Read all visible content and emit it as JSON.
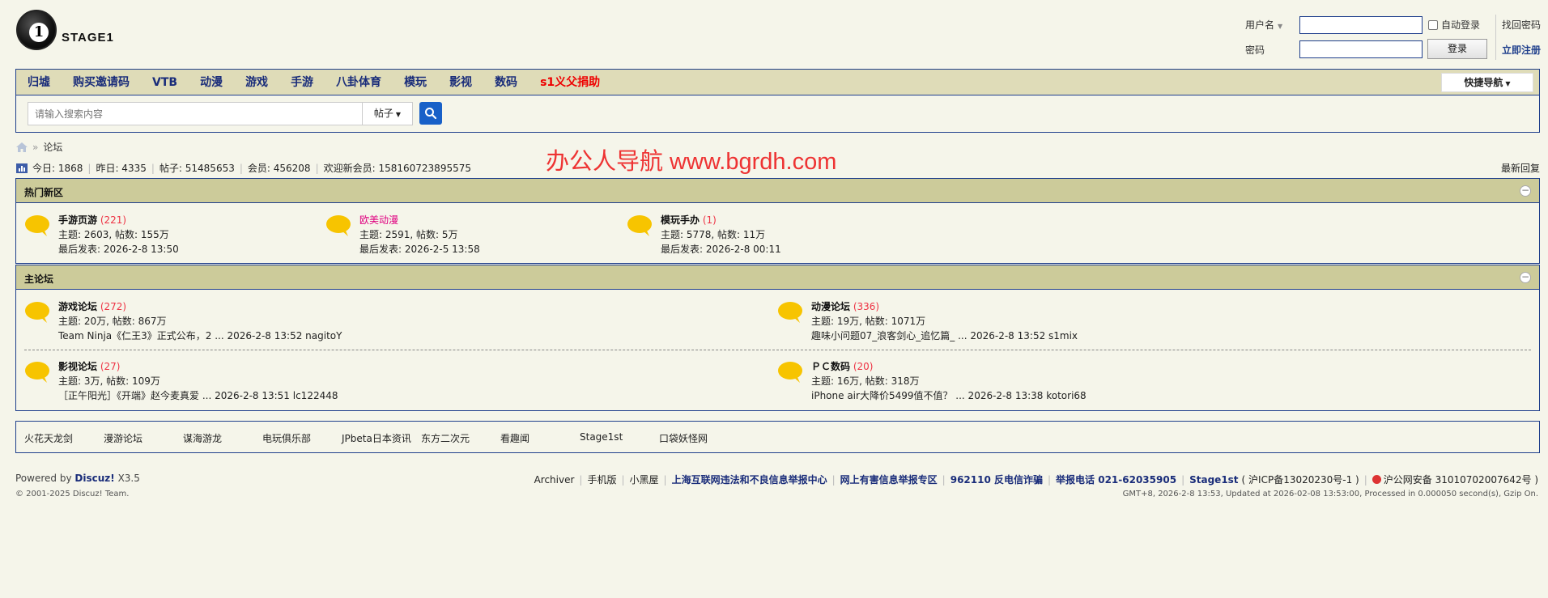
{
  "logo": {
    "text": "STAGE1",
    "digit": "1"
  },
  "login": {
    "username_label": "用户名",
    "password_label": "密码",
    "auto_login": "自动登录",
    "login_button": "登录",
    "find_password": "找回密码",
    "register": "立即注册"
  },
  "nav": {
    "items": [
      "归墟",
      "购买邀请码",
      "VTB",
      "动漫",
      "游戏",
      "手游",
      "八卦体育",
      "模玩",
      "影视",
      "数码",
      "s1义父捐助"
    ],
    "quick_nav": "快捷导航"
  },
  "search": {
    "placeholder": "请输入搜索内容",
    "type": "帖子"
  },
  "breadcrumb": {
    "current": "论坛",
    "separator": "»"
  },
  "stats": {
    "today": "今日: 1868",
    "yesterday": "昨日: 4335",
    "posts": "帖子: 51485653",
    "members": "会员: 456208",
    "welcome": "欢迎新会员: 158160723895575"
  },
  "latest_reply": "最新回复",
  "watermark": "办公人导航  www.bgrdh.com",
  "hot": {
    "title": "热门新区",
    "forums": [
      {
        "name": "手游页游",
        "count": "(221)",
        "stats": "主题: 2603, 帖数: 155万",
        "last": "最后发表: 2026-2-8 13:50"
      },
      {
        "name": "欧美动漫",
        "count": "",
        "stats": "主题: 2591, 帖数: 5万",
        "last": "最后发表: 2026-2-5 13:58"
      },
      {
        "name": "模玩手办",
        "count": "(1)",
        "stats": "主题: 5778, 帖数: 11万",
        "last": "最后发表: 2026-2-8 00:11"
      }
    ]
  },
  "main": {
    "title": "主论坛",
    "forums": [
      {
        "name": "游戏论坛",
        "count": "(272)",
        "stats": "主题: 20万, 帖数: 867万",
        "last": "Team Ninja《仁王3》正式公布，2 ... 2026-2-8 13:52 nagitoY"
      },
      {
        "name": "动漫论坛",
        "count": "(336)",
        "stats": "主题: 19万, 帖数: 1071万",
        "last": "趣味小问题07_浪客剑心_追忆篇_ ... 2026-2-8 13:52 s1mix"
      },
      {
        "name": "影视论坛",
        "count": "(27)",
        "stats": "主题: 3万, 帖数: 109万",
        "last": "［正午阳光］《开端》赵今麦真爱 ... 2026-2-8 13:51 lc122448"
      },
      {
        "name": "ＰＣ数码",
        "count": "(20)",
        "stats": "主题: 16万, 帖数: 318万",
        "last": "iPhone air大降价5499值不值？  ... 2026-2-8 13:38 kotori68"
      }
    ]
  },
  "friend_links": [
    "火花天龙剑",
    "漫游论坛",
    "谋海游龙",
    "电玩俱乐部",
    "JPbeta日本资讯",
    "东方二次元",
    "看趣闻",
    "Stage1st",
    "口袋妖怪网"
  ],
  "footer": {
    "powered_prefix": "Powered by",
    "powered_brand": "Discuz!",
    "powered_version": "X3.5",
    "copyright": "© 2001-2025 Discuz! Team.",
    "links": [
      "Archiver",
      "手机版",
      "小黑屋",
      "上海互联网违法和不良信息举报中心",
      "网上有害信息举报专区",
      "962110 反电信诈骗",
      "举报电话 021-62035905",
      "Stage1st",
      "( 沪ICP备13020230号-1 )",
      "沪公网安备 31010702007642号 )"
    ],
    "status": "GMT+8, 2026-2-8 13:53, Updated at 2026-02-08 13:53:00, Processed in 0.000050 second(s), Gzip On."
  },
  "colors": {
    "border": "#1f3f8c",
    "nav_bg": "#dfdcb8",
    "section_head": "#cccb9a",
    "bubble": "#f7c400",
    "link_red": "#e00"
  }
}
